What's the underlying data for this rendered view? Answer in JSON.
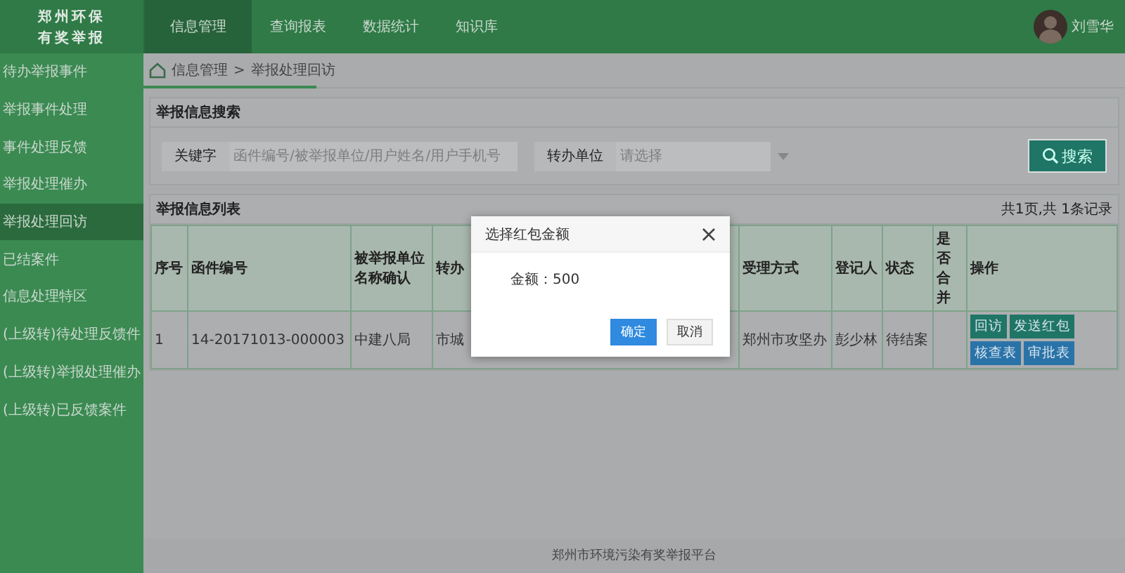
{
  "header": {
    "logo": [
      "郑州环保",
      "有奖举报"
    ],
    "nav": [
      {
        "label": "信息管理",
        "selected": true
      },
      {
        "label": "查询报表",
        "selected": false
      },
      {
        "label": "数据统计",
        "selected": false
      },
      {
        "label": "知识库",
        "selected": false
      }
    ],
    "user": "刘雪华"
  },
  "sidebar": {
    "items": [
      {
        "label": "待办举报事件",
        "selected": false
      },
      {
        "label": "举报事件处理",
        "selected": false
      },
      {
        "label": "事件处理反馈",
        "selected": false
      },
      {
        "label": "举报处理催办",
        "selected": false
      },
      {
        "label": "举报处理回访",
        "selected": true
      },
      {
        "label": "已结案件",
        "selected": false
      },
      {
        "label": "信息处理特区",
        "selected": false
      },
      {
        "label": "(上级转)待处理反馈件",
        "selected": false
      },
      {
        "label": "(上级转)举报处理催办",
        "selected": false
      },
      {
        "label": "(上级转)已反馈案件",
        "selected": false
      }
    ]
  },
  "breadcrumb": {
    "items": [
      "信息管理",
      "举报处理回访"
    ],
    "separator": ">"
  },
  "search_panel": {
    "title": "举报信息搜索",
    "keyword_label": "关键字",
    "keyword_placeholder": "函件编号/被举报单位/用户姓名/用户手机号",
    "unit_label": "转办单位",
    "unit_placeholder": "请选择",
    "search_button": "搜索"
  },
  "list_panel": {
    "title": "举报信息列表",
    "summary": "共1页,共 1条记录"
  },
  "table": {
    "columns": [
      "序号",
      "函件编号",
      "被举报单位名称确认",
      "转办",
      "受理方式",
      "登记人",
      "状态",
      "是否合并",
      "操作"
    ],
    "rows": [
      {
        "cells": [
          "1",
          "14-20171013-000003",
          "中建八局",
          "市城",
          "郑州市攻坚办",
          "彭少林",
          "待结案",
          null
        ],
        "actions": [
          {
            "label": "回访",
            "kind": "green"
          },
          {
            "label": "发送红包",
            "kind": "green"
          },
          {
            "label": "核查表",
            "kind": "blue"
          },
          {
            "label": "审批表",
            "kind": "blue"
          }
        ]
      }
    ]
  },
  "dialog": {
    "title": "选择红包金额",
    "amount": "金额：500",
    "buttons": [
      {
        "label": "确定",
        "kind": "primary"
      },
      {
        "label": "取消",
        "kind": "default"
      }
    ]
  },
  "footer": "郑州市环境污染有奖举报平台"
}
